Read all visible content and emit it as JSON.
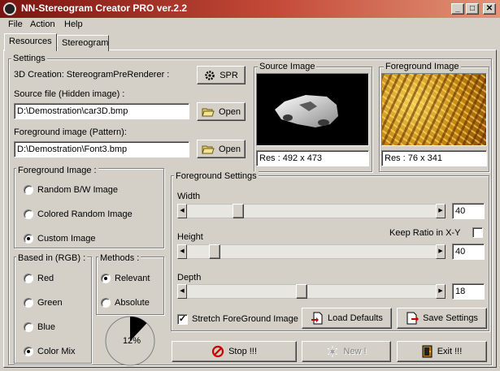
{
  "window": {
    "title": "NN-Stereogram Creator PRO ver.2.2"
  },
  "menu": [
    "File",
    "Action",
    "Help"
  ],
  "tabs": [
    {
      "label": "Resources",
      "active": true
    },
    {
      "label": "Stereogram",
      "active": false
    }
  ],
  "settings": {
    "legend": "Settings",
    "creation_label": "3D Creation: StereogramPreRenderer :",
    "spr_button": "SPR",
    "source_label": "Source file (Hidden image) :",
    "source_value": "D:\\Demostration\\car3D.bmp",
    "foreground_label": "Foreground image (Pattern):",
    "foreground_value": "D:\\Demostration\\Font3.bmp",
    "open_button": "Open"
  },
  "source_image": {
    "legend": "Source Image",
    "res": "Res : 492 x 473"
  },
  "foreground_image": {
    "legend": "Foreground Image",
    "res": "Res : 76 x 341"
  },
  "fg_image_group": {
    "legend": "Foreground Image :",
    "options": [
      "Random B/W Image",
      "Colored Random Image",
      "Custom Image"
    ],
    "selected": 2
  },
  "rgb_group": {
    "legend": "Based in (RGB) :",
    "options": [
      "Red",
      "Green",
      "Blue",
      "Color Mix"
    ],
    "selected": 3
  },
  "methods_group": {
    "legend": "Methods :",
    "options": [
      "Relevant",
      "Absolute"
    ],
    "selected": 0
  },
  "progress": {
    "value_percent": 12,
    "label": "12%"
  },
  "fg_settings": {
    "legend": "Foreground Settings",
    "width_label": "Width",
    "width_value": "40",
    "width_fraction": 0.19,
    "keep_ratio_label": "Keep Ratio in X-Y",
    "keep_ratio_checked": false,
    "height_label": "Height",
    "height_value": "40",
    "height_fraction": 0.09,
    "depth_label": "Depth",
    "depth_value": "18",
    "depth_fraction": 0.46,
    "stretch_label": "Stretch ForeGround Image",
    "stretch_checked": true,
    "load_defaults": "Load Defaults",
    "save_settings": "Save Settings"
  },
  "actions": {
    "stop": "Stop !!!",
    "new": "New !",
    "exit": "Exit !!!"
  },
  "colors": {
    "title_start": "#7a1410",
    "title_end": "#e29478",
    "face": "#d4d0c8",
    "stop_icon": "#cc0000"
  }
}
